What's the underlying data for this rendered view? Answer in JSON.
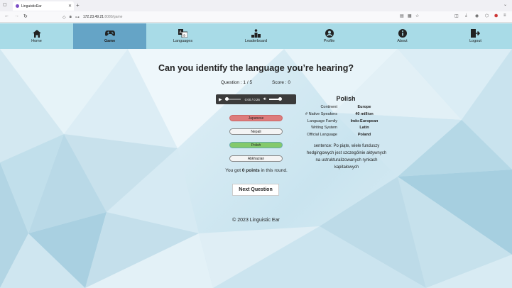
{
  "browser": {
    "tab_title": "LinguisticEar",
    "url_host": "172.23.49.21",
    "url_path": ":8080/game"
  },
  "nav": {
    "items": [
      {
        "label": "Home",
        "icon": "home-icon"
      },
      {
        "label": "Game",
        "icon": "gamepad-icon"
      },
      {
        "label": "Languages",
        "icon": "translate-icon"
      },
      {
        "label": "Leaderboard",
        "icon": "podium-icon"
      },
      {
        "label": "Profile",
        "icon": "profile-icon"
      },
      {
        "label": "About",
        "icon": "info-icon"
      },
      {
        "label": "Logout",
        "icon": "logout-icon"
      }
    ],
    "active": "Game",
    "colors": {
      "bar": "#a8dbe7",
      "active": "#65a4c6"
    }
  },
  "game": {
    "title": "Can you identify the language you’re hearing?",
    "question_label": "Question : 1 / 5",
    "score_label": "Score : 0",
    "audio": {
      "time": "0:00 / 0:26",
      "progress": 0,
      "volume": 1
    },
    "options": [
      {
        "label": "Japanese",
        "state": "wrong"
      },
      {
        "label": "Nepali",
        "state": "neutral"
      },
      {
        "label": "Polish",
        "state": "correct"
      },
      {
        "label": "Abkhazian",
        "state": "neutral"
      }
    ],
    "result_prefix": "You got ",
    "result_points": "0 points",
    "result_suffix": " in this round.",
    "next_button": "Next Question"
  },
  "info": {
    "language": "Polish",
    "rows": [
      {
        "key": "Continent",
        "value": "Europe"
      },
      {
        "key": "# Native Speakers",
        "value": "40 million"
      },
      {
        "key": "Language Family",
        "value": "Indo-European"
      },
      {
        "key": "Writing System",
        "value": "Latin"
      },
      {
        "key": "Official Language",
        "value": "Poland"
      }
    ],
    "sentence": "sentence: Po piąte, wiele funduszy hedgingowych jest szczególnie aktywnych na ustrukturalizowanych rynkach kapitałowych"
  },
  "footer": "© 2023 Linguistic Ear"
}
